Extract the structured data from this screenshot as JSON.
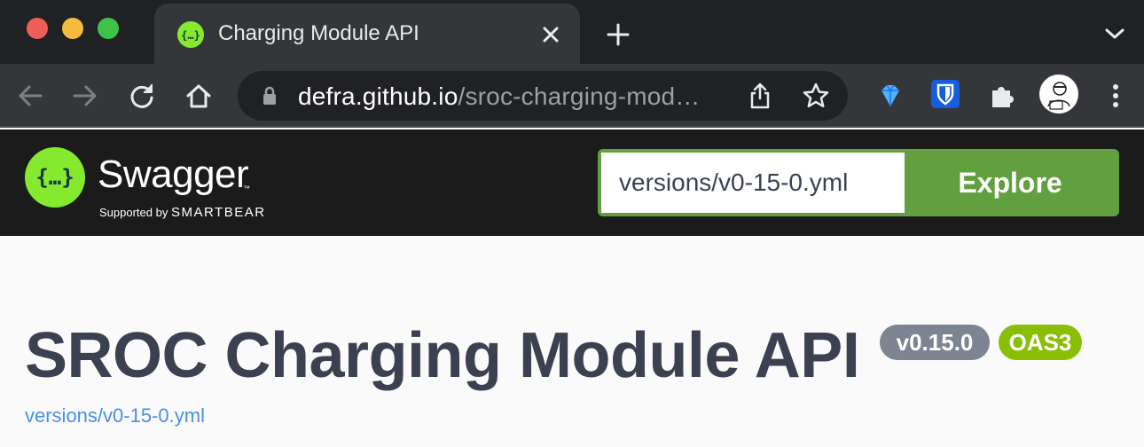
{
  "browser": {
    "tab": {
      "title": "Charging Module API",
      "favicon": "swagger-favicon-icon"
    },
    "address": {
      "host": "defra.github.io",
      "path": "/sroc-charging-mod…"
    },
    "icons": [
      "back-icon",
      "forward-icon",
      "reload-icon",
      "home-icon",
      "lock-icon",
      "share-icon",
      "star-icon",
      "gem-extension-icon",
      "bitwarden-extension-icon",
      "puzzle-extensions-icon",
      "profile-avatar",
      "kebab-menu-icon",
      "new-tab-icon",
      "tab-search-icon",
      "close-icon"
    ],
    "colors": {
      "tabstrip": "#202124",
      "toolbar": "#35363a",
      "omnibox": "#202124"
    }
  },
  "swagger": {
    "logo_word": "Swagger",
    "tm": "™",
    "supported_prefix": "Supported by",
    "supported_brand": "SMARTBEAR",
    "explore_value": "versions/v0-15-0.yml",
    "explore_label": "Explore",
    "colors": {
      "bar": "#1b1b1b",
      "accent": "#62a03f",
      "logo": "#85ea2d"
    }
  },
  "info": {
    "title": "SROC Charging Module API",
    "version_badge": "v0.15.0",
    "oas_badge": "OAS3",
    "spec_link": "versions/v0-15-0.yml",
    "colors": {
      "title": "#3b4151",
      "version": "#7d8492",
      "oas": "#89bf04",
      "link": "#4990e2"
    }
  }
}
